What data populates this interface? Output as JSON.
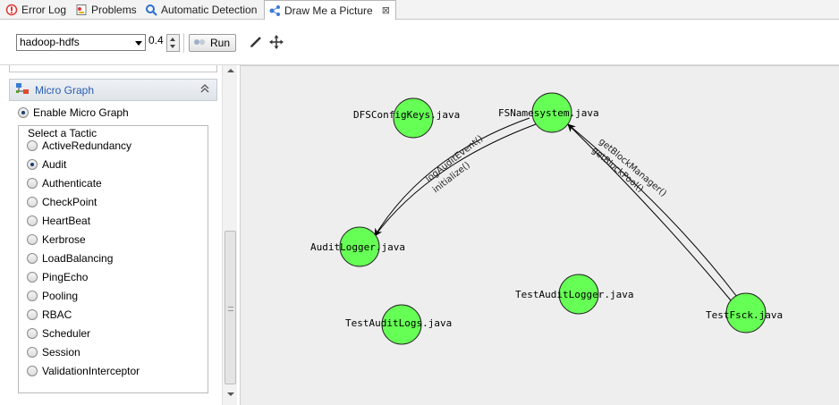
{
  "tabs": [
    {
      "label": "Error Log",
      "icon": "error-log-icon"
    },
    {
      "label": "Problems",
      "icon": "problems-icon"
    },
    {
      "label": "Automatic Detection",
      "icon": "search-icon"
    },
    {
      "label": "Draw Me a Picture",
      "icon": "graph-icon",
      "close": "⊠"
    }
  ],
  "toolbar": {
    "project": "hadoop-hdfs",
    "threshold": "0.4",
    "run_label": "Run"
  },
  "panel": {
    "title": "Micro Graph",
    "enable_label": "Enable Micro Graph",
    "group_label": "Select a Tactic",
    "selected": "Audit",
    "tactics": [
      "ActiveRedundancy",
      "Audit",
      "Authenticate",
      "CheckPoint",
      "HeartBeat",
      "Kerbrose",
      "LoadBalancing",
      "PingEcho",
      "Pooling",
      "RBAC",
      "Scheduler",
      "Session",
      "ValidationInterceptor"
    ]
  },
  "graph": {
    "node_color": "#66ff55",
    "nodes": [
      {
        "id": "dfs",
        "label": "DFSConfigKeys.java"
      },
      {
        "id": "fsn",
        "label": "FSNamesystem.java"
      },
      {
        "id": "audit",
        "label": "AuditLogger.java"
      },
      {
        "id": "tal",
        "label": "TestAuditLogger.java"
      },
      {
        "id": "tlogs",
        "label": "TestAuditLogs.java"
      },
      {
        "id": "fsck",
        "label": "TestFsck.java"
      }
    ],
    "edges": [
      {
        "from": "fsn",
        "to": "audit",
        "labels": [
          "logAuditEvent()",
          "initialize()"
        ]
      },
      {
        "from": "fsck",
        "to": "fsn",
        "labels": [
          "getBlockManager()",
          "getBlockPool()"
        ]
      }
    ]
  }
}
